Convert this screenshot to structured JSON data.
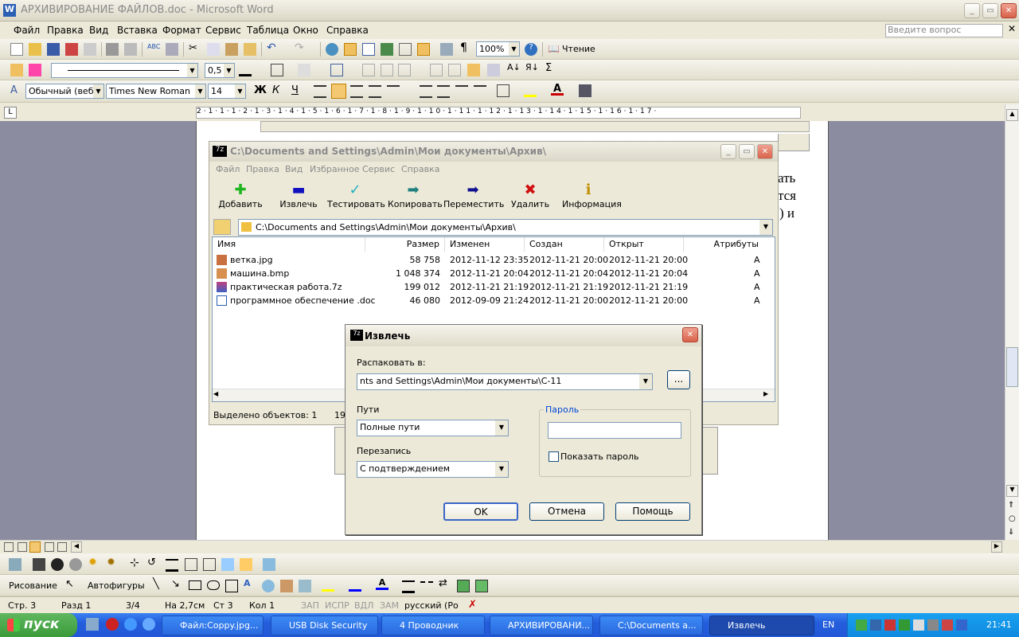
{
  "word": {
    "title": "АРХИВИРОВАНИЕ ФАЙЛОВ.doc - Microsoft Word",
    "menu": [
      "Файл",
      "Правка",
      "Вид",
      "Вставка",
      "Формат",
      "Сервис",
      "Таблица",
      "Окно",
      "Справка"
    ],
    "help_placeholder": "Введите вопрос",
    "zoom": "100%",
    "reading": "Чтение",
    "line_width": "0,5",
    "style": "Обычный (веб)",
    "font": "Times New Roman",
    "size": "14",
    "page_text": [
      "ать",
      "тся",
      ") и"
    ]
  },
  "sevenzip": {
    "title": "C:\\Documents and Settings\\Admin\\Мои документы\\Архив\\",
    "menu": [
      "Файл",
      "Правка",
      "Вид",
      "Избранное",
      "Сервис",
      "Справка"
    ],
    "tools": [
      {
        "label": "Добавить",
        "icon": "add-icon"
      },
      {
        "label": "Извлечь",
        "icon": "extract-icon"
      },
      {
        "label": "Тестировать",
        "icon": "test-icon"
      },
      {
        "label": "Копировать",
        "icon": "copy-icon"
      },
      {
        "label": "Переместить",
        "icon": "move-icon"
      },
      {
        "label": "Удалить",
        "icon": "delete-icon"
      },
      {
        "label": "Информация",
        "icon": "info-icon"
      }
    ],
    "address": "C:\\Documents and Settings\\Admin\\Мои документы\\Архив\\",
    "columns": [
      "Имя",
      "Размер",
      "Изменен",
      "Создан",
      "Открыт",
      "Атрибуты"
    ],
    "files": [
      {
        "name": "ветка.jpg",
        "size": "58 758",
        "modified": "2012-11-12 23:35",
        "created": "2012-11-21 20:00",
        "opened": "2012-11-21 20:00",
        "attr": "A"
      },
      {
        "name": "машина.bmp",
        "size": "1 048 374",
        "modified": "2012-11-21 20:04",
        "created": "2012-11-21 20:04",
        "opened": "2012-11-21 20:04",
        "attr": "A"
      },
      {
        "name": "практическая работа.7z",
        "size": "199 012",
        "modified": "2012-11-21 21:19",
        "created": "2012-11-21 21:19",
        "opened": "2012-11-21 21:19",
        "attr": "A"
      },
      {
        "name": "программное обеспечение .doc",
        "size": "46 080",
        "modified": "2012-09-09 21:24",
        "created": "2012-11-21 20:00",
        "opened": "2012-11-21 20:00",
        "attr": "A"
      }
    ],
    "status": "Выделено объектов: 1",
    "status2": "19"
  },
  "dialog": {
    "title": "Извлечь",
    "extract_to_label": "Распаковать в:",
    "extract_to": "nts and Settings\\Admin\\Мои документы\\С-11",
    "browse": "...",
    "paths_label": "Пути",
    "paths": "Полные пути",
    "overwrite_label": "Перезапись",
    "overwrite": "С подтверждением",
    "password_group": "Пароль",
    "password": "",
    "show_password": "Показать пароль",
    "ok": "OK",
    "cancel": "Отмена",
    "help": "Помощь"
  },
  "drawing": {
    "draw": "Рисование",
    "autoshapes": "Автофигуры"
  },
  "statusbar": {
    "page": "Стр. 3",
    "section": "Разд 1",
    "pages": "3/4",
    "at": "На 2,7см",
    "line": "Ст 3",
    "col": "Кол 1",
    "rec": "ЗАП",
    "trk": "ИСПР",
    "ext": "ВДЛ",
    "ovr": "ЗАМ",
    "lang": "русский (Ро"
  },
  "taskbar": {
    "start": "пуск",
    "tasks": [
      "Файл:Coppy.jpg...",
      "USB Disk Security",
      "4 Проводник",
      "АРХИВИРОВАНИ...",
      "C:\\Documents a...",
      "Извлечь"
    ],
    "lang": "EN",
    "clock": "21:41"
  }
}
